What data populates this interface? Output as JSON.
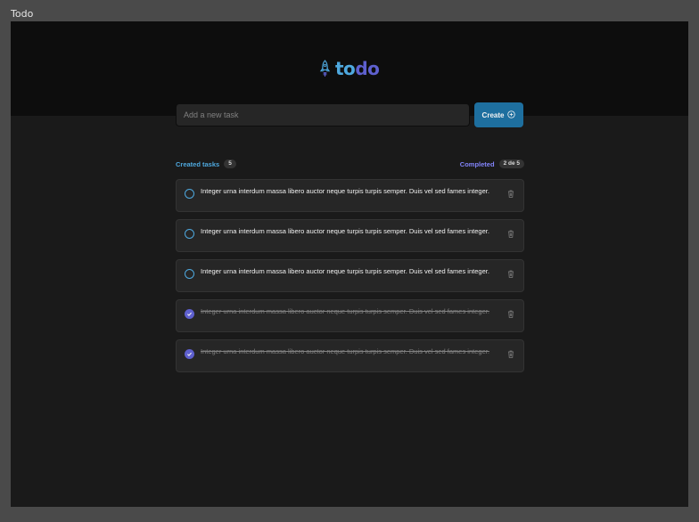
{
  "window": {
    "title": "Todo"
  },
  "logo": {
    "part1": "to",
    "part2": "do",
    "icon": "rocket-icon"
  },
  "new_task": {
    "placeholder": "Add a new task",
    "value": "",
    "button_label": "Create",
    "button_icon": "plus-circle-icon"
  },
  "counters": {
    "created_label": "Created tasks",
    "created_count": "5",
    "completed_label": "Completed",
    "completed_count": "2 de 5"
  },
  "tasks": [
    {
      "text": "Integer urna interdum massa libero auctor neque turpis turpis semper. Duis vel sed fames integer.",
      "completed": false
    },
    {
      "text": "Integer urna interdum massa libero auctor neque turpis turpis semper. Duis vel sed fames integer.",
      "completed": false
    },
    {
      "text": "Integer urna interdum massa libero auctor neque turpis turpis semper. Duis vel sed fames integer.",
      "completed": false
    },
    {
      "text": "Integer urna interdum massa libero auctor neque turpis turpis semper. Duis vel sed fames integer.",
      "completed": true
    },
    {
      "text": "Integer urna interdum massa libero auctor neque turpis turpis semper. Duis vel sed fames integer.",
      "completed": true
    }
  ],
  "colors": {
    "brand_blue": "#4ea8de",
    "brand_purple": "#5e60ce",
    "purple_light": "#8284fa",
    "button_blue": "#1e6f9f",
    "background": "#1a1a1a",
    "header": "#0d0d0d",
    "card": "#262626"
  }
}
